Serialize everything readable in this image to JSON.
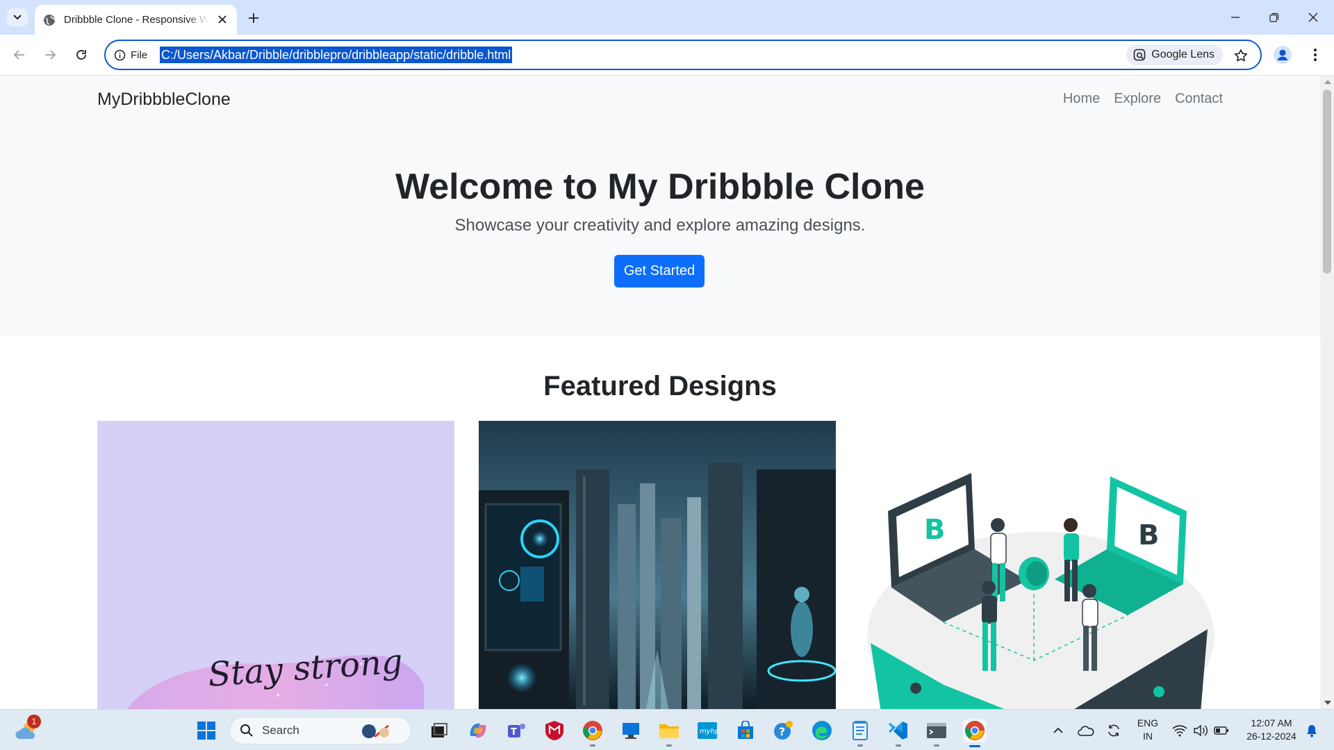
{
  "browser": {
    "tab_title": "Dribbble Clone - Responsive W",
    "address_chip": "File",
    "url": "C:/Users/Akbar/Dribble/dribblepro/dribbleapp/static/dribble.html",
    "lens_label": "Google Lens"
  },
  "site": {
    "brand": "MyDribbbleClone",
    "nav": [
      "Home",
      "Explore",
      "Contact"
    ],
    "hero_title": "Welcome to My Dribbble Clone",
    "hero_subtitle": "Showcase your creativity and explore amazing designs.",
    "hero_button": "Get Started",
    "featured_title": "Featured Designs",
    "card1_script": "Stay strong"
  },
  "taskbar": {
    "search_placeholder": "Search",
    "weather_badge": "1",
    "language_line1": "ENG",
    "language_line2": "IN",
    "time": "12:07 AM",
    "date": "26-12-2024"
  },
  "colors": {
    "accent": "#0d6efd",
    "chrome_accent": "#0b57d0",
    "teal": "#13c4a3"
  }
}
